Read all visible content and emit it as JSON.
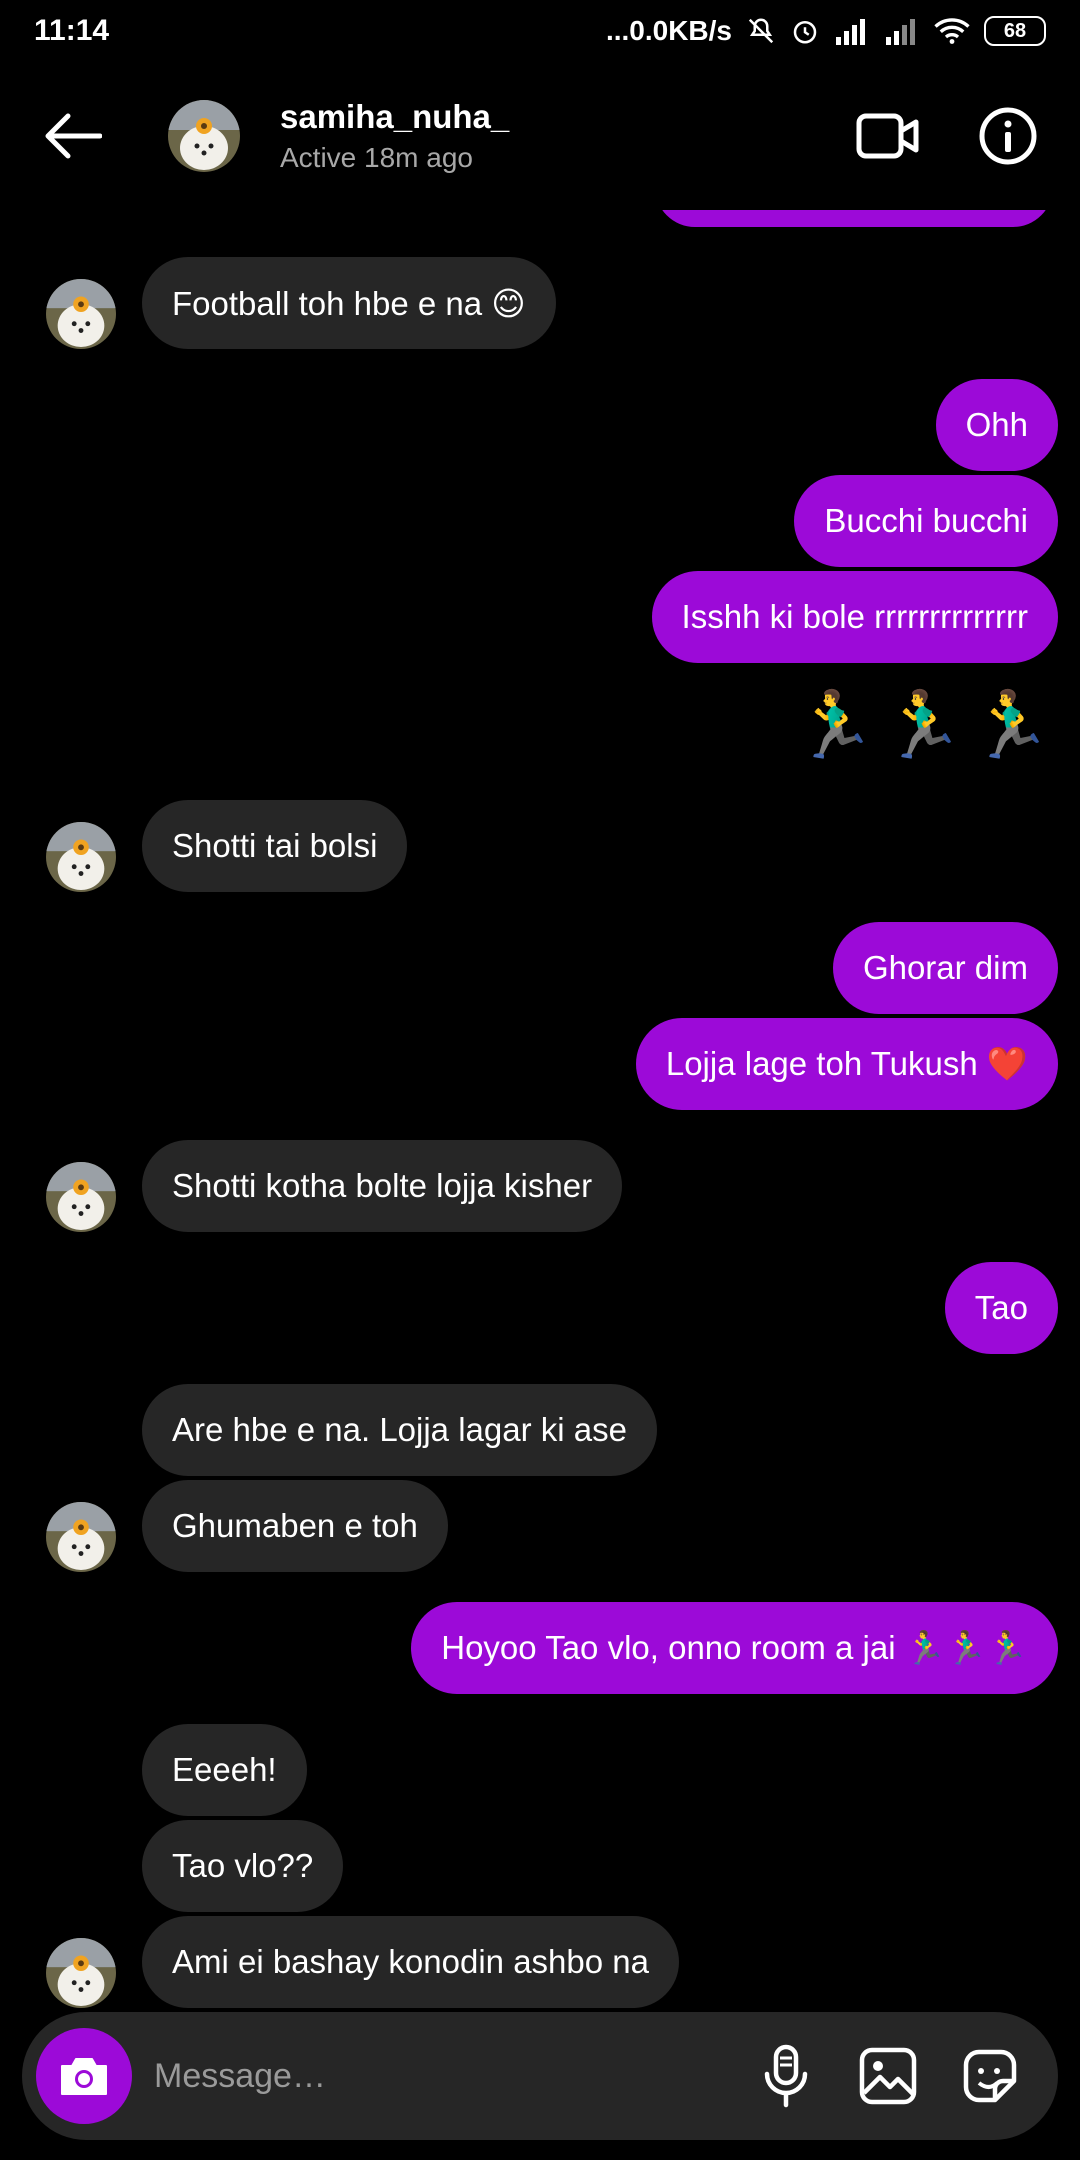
{
  "status_bar": {
    "time": "11:14",
    "network": "...0.0KB/s",
    "battery": "68"
  },
  "header": {
    "name": "samiha_nuha_",
    "status": "Active 18m ago"
  },
  "messages": [
    {
      "dir": "in",
      "text": "Football toh hbe e na 😊"
    },
    {
      "dir": "out",
      "text": "Ohh"
    },
    {
      "dir": "out",
      "text": "Bucchi bucchi"
    },
    {
      "dir": "out",
      "text": "Isshh ki bole rrrrrrrrrrrrrr"
    },
    {
      "dir": "out",
      "text": "🏃‍♂️🏃‍♂️🏃‍♂️"
    },
    {
      "dir": "in",
      "text": "Shotti tai bolsi"
    },
    {
      "dir": "out",
      "text": "Ghorar dim"
    },
    {
      "dir": "out",
      "text": "Lojja lage toh Tukush ❤️"
    },
    {
      "dir": "in",
      "text": "Shotti kotha bolte lojja kisher"
    },
    {
      "dir": "out",
      "text": "Tao"
    },
    {
      "dir": "in",
      "text": "Are hbe e na. Lojja lagar ki ase"
    },
    {
      "dir": "in",
      "text": "Ghumaben e toh"
    },
    {
      "dir": "out",
      "text": "Hoyoo Tao vlo, onno room a jai 🏃‍♂️🏃‍♂️🏃‍♂️"
    },
    {
      "dir": "in",
      "text": "Eeeeh!"
    },
    {
      "dir": "in",
      "text": "Tao vlo??"
    },
    {
      "dir": "in",
      "text": "Ami ei bashay konodin  ashbo na"
    }
  ],
  "composer": {
    "placeholder": "Message…"
  },
  "icons": {
    "back": "arrow-left-icon",
    "video": "video-camera-icon",
    "info": "info-icon",
    "camera": "camera-icon",
    "mic": "microphone-icon",
    "gallery": "image-icon",
    "sticker": "sticker-icon"
  },
  "colors": {
    "outgoing_bubble": "#9c0ad8",
    "incoming_bubble": "#262626",
    "background": "#000000"
  }
}
